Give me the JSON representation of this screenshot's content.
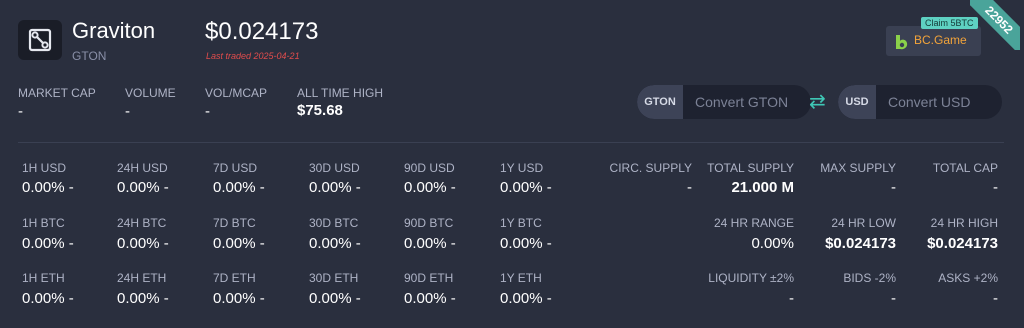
{
  "coin": {
    "name": "Graviton",
    "symbol": "GTON",
    "price": "$0.024173",
    "last_traded": "Last traded 2025-04-21",
    "icon": "graviton-logo-icon"
  },
  "ad": {
    "claim": "Claim 5BTC",
    "brand": "BC.Game",
    "badge": "22952",
    "brand_color": "#f2a33a",
    "accent": "#5ed1c2"
  },
  "stats": [
    {
      "label": "MARKET CAP",
      "value": "-"
    },
    {
      "label": "VOLUME",
      "value": "-"
    },
    {
      "label": "VOL/MCAP",
      "value": "-"
    },
    {
      "label": "ALL TIME HIGH",
      "value": "$75.68"
    }
  ],
  "converter": {
    "from_currency": "GTON",
    "from_placeholder": "Convert GTON",
    "to_currency": "USD",
    "to_placeholder": "Convert USD",
    "swap_icon": "swap-arrows-icon"
  },
  "changes": {
    "usd": [
      {
        "label": "1H USD",
        "value": "0.00% -"
      },
      {
        "label": "24H USD",
        "value": "0.00% -"
      },
      {
        "label": "7D USD",
        "value": "0.00% -"
      },
      {
        "label": "30D USD",
        "value": "0.00% -"
      },
      {
        "label": "90D USD",
        "value": "0.00% -"
      },
      {
        "label": "1Y USD",
        "value": "0.00% -"
      }
    ],
    "btc": [
      {
        "label": "1H BTC",
        "value": "0.00% -"
      },
      {
        "label": "24H BTC",
        "value": "0.00% -"
      },
      {
        "label": "7D BTC",
        "value": "0.00% -"
      },
      {
        "label": "30D BTC",
        "value": "0.00% -"
      },
      {
        "label": "90D BTC",
        "value": "0.00% -"
      },
      {
        "label": "1Y BTC",
        "value": "0.00% -"
      }
    ],
    "eth": [
      {
        "label": "1H ETH",
        "value": "0.00% -"
      },
      {
        "label": "24H ETH",
        "value": "0.00% -"
      },
      {
        "label": "7D ETH",
        "value": "0.00% -"
      },
      {
        "label": "30D ETH",
        "value": "0.00% -"
      },
      {
        "label": "90D ETH",
        "value": "0.00% -"
      },
      {
        "label": "1Y ETH",
        "value": "0.00% -"
      }
    ]
  },
  "supply": {
    "row1": [
      {
        "label": "CIRC. SUPPLY",
        "value": "-"
      },
      {
        "label": "TOTAL SUPPLY",
        "value": "21.000 M"
      },
      {
        "label": "MAX SUPPLY",
        "value": "-"
      },
      {
        "label": "TOTAL CAP",
        "value": "-"
      }
    ],
    "row2": [
      {
        "label": "24 HR RANGE",
        "value": "0.00%"
      },
      {
        "label": "24 HR LOW",
        "value": "$0.024173"
      },
      {
        "label": "24 HR HIGH",
        "value": "$0.024173"
      }
    ],
    "row3": [
      {
        "label": "LIQUIDITY ±2%",
        "value": "-"
      },
      {
        "label": "BIDS -2%",
        "value": "-"
      },
      {
        "label": "ASKS +2%",
        "value": "-"
      }
    ]
  }
}
